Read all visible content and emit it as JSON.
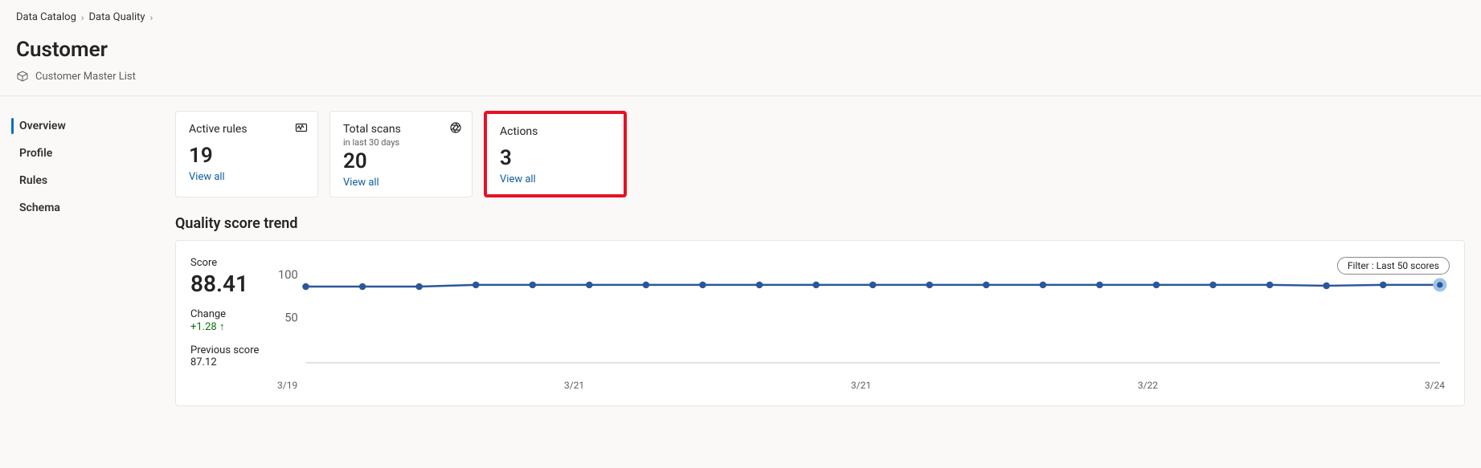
{
  "breadcrumb": {
    "items": [
      "Data Catalog",
      "Data Quality"
    ]
  },
  "page": {
    "title": "Customer",
    "subtitle": "Customer Master List"
  },
  "sidenav": {
    "items": [
      {
        "label": "Overview",
        "active": true
      },
      {
        "label": "Profile",
        "active": false
      },
      {
        "label": "Rules",
        "active": false
      },
      {
        "label": "Schema",
        "active": false
      }
    ]
  },
  "cards": {
    "activeRules": {
      "title": "Active rules",
      "value": "19",
      "link": "View all"
    },
    "totalScans": {
      "title": "Total scans",
      "subtitle": "in last 30 days",
      "value": "20",
      "link": "View all"
    },
    "actions": {
      "title": "Actions",
      "value": "3",
      "link": "View all"
    }
  },
  "trend": {
    "sectionTitle": "Quality score trend",
    "scoreLabel": "Score",
    "score": "88.41",
    "changeLabel": "Change",
    "change": "+1.28 ↑",
    "prevLabel": "Previous score",
    "prev": "87.12",
    "filterLabel": "Filter : Last 50 scores",
    "yTicks": [
      "100",
      "50"
    ]
  },
  "chart_data": {
    "type": "line",
    "title": "Quality score trend",
    "xlabel": "",
    "ylabel": "",
    "ylim": [
      0,
      100
    ],
    "xTicks": [
      "3/19",
      "3/21",
      "3/21",
      "3/22",
      "3/24"
    ],
    "series": [
      {
        "name": "Quality score",
        "values": [
          86,
          86,
          86,
          88,
          88,
          88,
          88,
          88,
          88,
          88,
          88,
          88,
          88,
          88,
          88,
          88,
          88,
          88,
          87,
          88,
          88
        ]
      }
    ]
  }
}
